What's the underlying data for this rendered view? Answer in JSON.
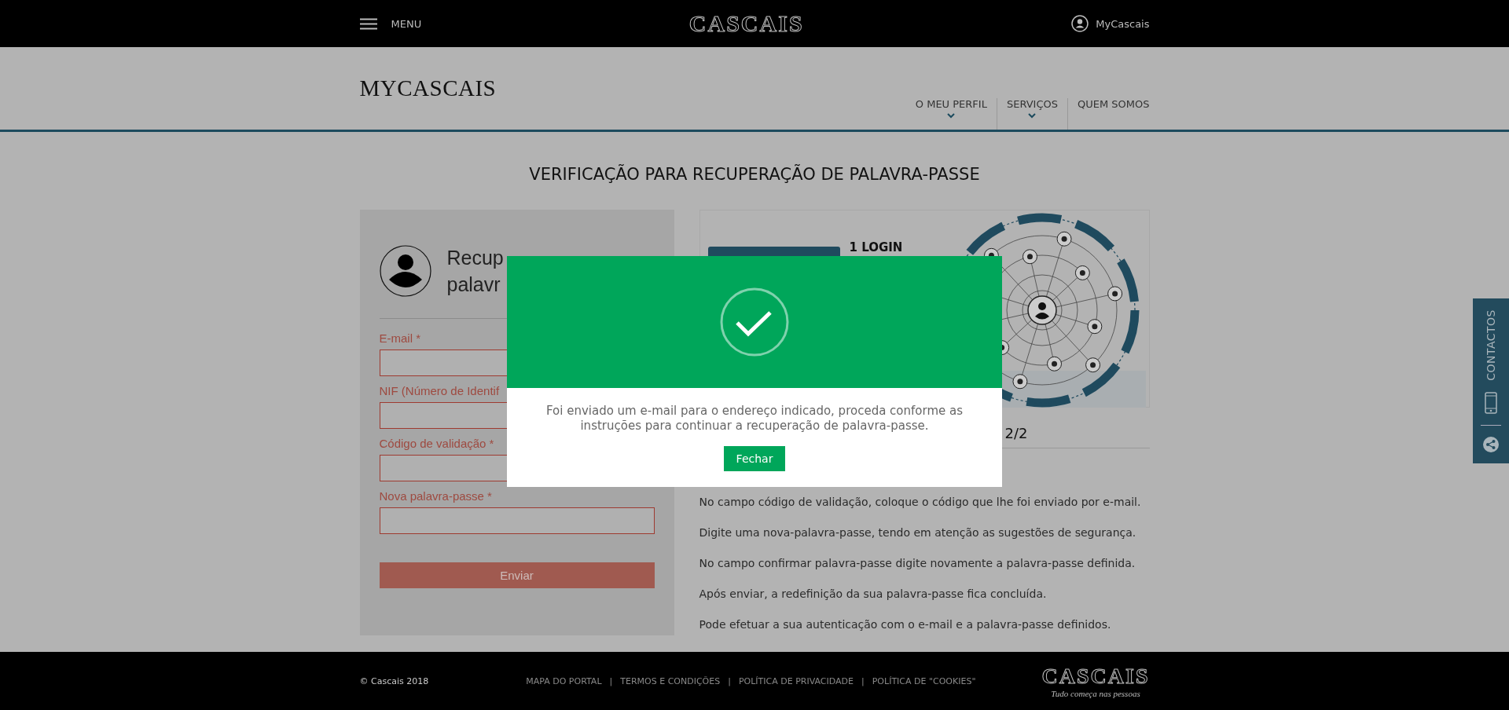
{
  "top_bar": {
    "menu_label": "MENU",
    "logo": "CASCAIS",
    "account_label": "MyCascais"
  },
  "header": {
    "title": "MYCASCAIS",
    "nav": [
      {
        "label": "O MEU PERFIL",
        "has_dropdown": true
      },
      {
        "label": "SERVIÇOS",
        "has_dropdown": true
      },
      {
        "label": "QUEM SOMOS",
        "has_dropdown": false
      }
    ]
  },
  "page_title": "VERIFICAÇÃO PARA RECUPERAÇÃO DE PALAVRA-PASSE",
  "form": {
    "heading_lines": [
      "Recup",
      "palavr"
    ],
    "fields": [
      {
        "label": "E-mail *"
      },
      {
        "label": "NIF (Número de Identif"
      },
      {
        "label": "Código de validação *"
      },
      {
        "label": "Nova palavra-passe *"
      }
    ],
    "submit": "Enviar"
  },
  "banner": {
    "label": "1 LOGIN"
  },
  "steps": {
    "heading": "2/2",
    "items": [
      "No campo código de validação, coloque o código que lhe foi enviado por e-mail.",
      "Digite uma nova-palavra-passe, tendo em atenção as sugestões de segurança.",
      "No campo confirmar palavra-passe digite novamente a palavra-passe definida.",
      "Após enviar, a redefinição da sua palavra-passe fica concluída.",
      "Pode efetuar a sua autenticação com o e-mail e a palavra-passe definidos."
    ]
  },
  "footer": {
    "copyright": "© Cascais 2018",
    "separator": "|",
    "links": [
      "MAPA DO PORTAL",
      "TERMOS E CONDIÇÕES",
      "POLÍTICA DE PRIVACIDADE",
      "POLÍTICA DE \"COOKIES\""
    ],
    "logo": "CASCAIS",
    "tagline": "Tudo começa nas pessoas"
  },
  "side_tab": {
    "label": "CONTACTOS"
  },
  "dialog": {
    "message": "Foi enviado um e-mail para o endereço indicado, proceda conforme as instruções para continuar a recuperação de palavra-passe.",
    "button": "Fechar"
  }
}
